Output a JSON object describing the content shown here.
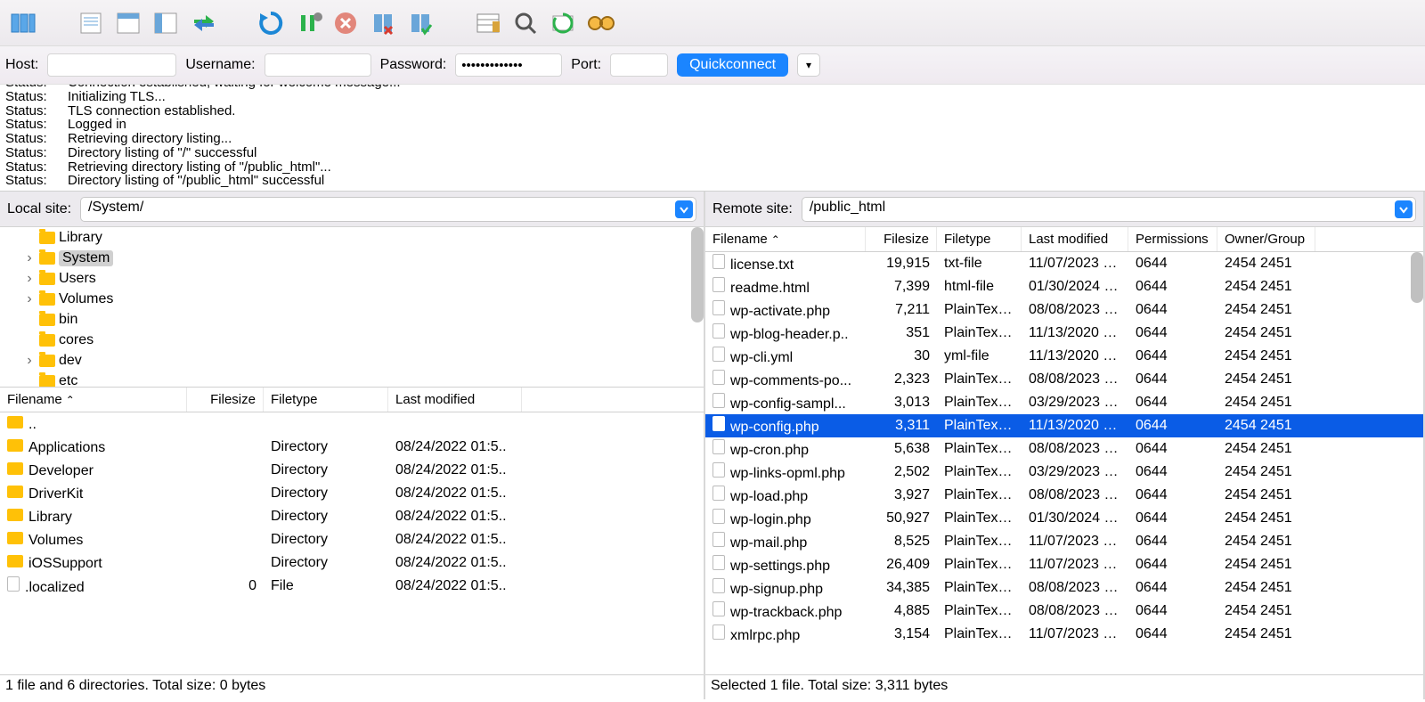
{
  "conn": {
    "host_label": "Host:",
    "username_label": "Username:",
    "password_label": "Password:",
    "password_mask": "•••••••••••••",
    "port_label": "Port:",
    "quickconnect": "Quickconnect"
  },
  "log": [
    {
      "k": "Status:",
      "v": "Connection established, waiting for welcome message..."
    },
    {
      "k": "Status:",
      "v": "Initializing TLS..."
    },
    {
      "k": "Status:",
      "v": "TLS connection established."
    },
    {
      "k": "Status:",
      "v": "Logged in"
    },
    {
      "k": "Status:",
      "v": "Retrieving directory listing..."
    },
    {
      "k": "Status:",
      "v": "Directory listing of \"/\" successful"
    },
    {
      "k": "Status:",
      "v": "Retrieving directory listing of \"/public_html\"..."
    },
    {
      "k": "Status:",
      "v": "Directory listing of \"/public_html\" successful"
    }
  ],
  "local": {
    "label": "Local site:",
    "path": "/System/",
    "tree": [
      {
        "caret": "",
        "name": "Library",
        "sel": false
      },
      {
        "caret": "›",
        "name": "System",
        "sel": true
      },
      {
        "caret": "›",
        "name": "Users",
        "sel": false
      },
      {
        "caret": "›",
        "name": "Volumes",
        "sel": false
      },
      {
        "caret": "",
        "name": "bin",
        "sel": false
      },
      {
        "caret": "",
        "name": "cores",
        "sel": false
      },
      {
        "caret": "›",
        "name": "dev",
        "sel": false
      },
      {
        "caret": "",
        "name": "etc",
        "sel": false
      }
    ],
    "headers": {
      "fn": "Filename",
      "fs": "Filesize",
      "ft": "Filetype",
      "lm": "Last modified"
    },
    "rows": [
      {
        "icon": "folder",
        "name": "..",
        "size": "",
        "type": "",
        "date": ""
      },
      {
        "icon": "folder",
        "name": "Applications",
        "size": "",
        "type": "Directory",
        "date": "08/24/2022 01:5.."
      },
      {
        "icon": "folder",
        "name": "Developer",
        "size": "",
        "type": "Directory",
        "date": "08/24/2022 01:5.."
      },
      {
        "icon": "folder",
        "name": "DriverKit",
        "size": "",
        "type": "Directory",
        "date": "08/24/2022 01:5.."
      },
      {
        "icon": "folder",
        "name": "Library",
        "size": "",
        "type": "Directory",
        "date": "08/24/2022 01:5.."
      },
      {
        "icon": "folder",
        "name": "Volumes",
        "size": "",
        "type": "Directory",
        "date": "08/24/2022 01:5.."
      },
      {
        "icon": "folder",
        "name": "iOSSupport",
        "size": "",
        "type": "Directory",
        "date": "08/24/2022 01:5.."
      },
      {
        "icon": "file",
        "name": ".localized",
        "size": "0",
        "type": "File",
        "date": "08/24/2022 01:5.."
      }
    ],
    "footer": "1 file and 6 directories. Total size: 0 bytes"
  },
  "remote": {
    "label": "Remote site:",
    "path": "/public_html",
    "headers": {
      "fn": "Filename",
      "fs": "Filesize",
      "ft": "Filetype",
      "lm": "Last modified",
      "pm": "Permissions",
      "og": "Owner/Group"
    },
    "rows": [
      {
        "name": "license.txt",
        "size": "19,915",
        "type": "txt-file",
        "date": "11/07/2023 1...",
        "perm": "0644",
        "og": "2454 2451",
        "sel": false
      },
      {
        "name": "readme.html",
        "size": "7,399",
        "type": "html-file",
        "date": "01/30/2024 1...",
        "perm": "0644",
        "og": "2454 2451",
        "sel": false
      },
      {
        "name": "wp-activate.php",
        "size": "7,211",
        "type": "PlainTextT...",
        "date": "08/08/2023 1...",
        "perm": "0644",
        "og": "2454 2451",
        "sel": false
      },
      {
        "name": "wp-blog-header.p..",
        "size": "351",
        "type": "PlainTextT...",
        "date": "11/13/2020 0...",
        "perm": "0644",
        "og": "2454 2451",
        "sel": false
      },
      {
        "name": "wp-cli.yml",
        "size": "30",
        "type": "yml-file",
        "date": "11/13/2020 1...",
        "perm": "0644",
        "og": "2454 2451",
        "sel": false
      },
      {
        "name": "wp-comments-po...",
        "size": "2,323",
        "type": "PlainTextT...",
        "date": "08/08/2023 1...",
        "perm": "0644",
        "og": "2454 2451",
        "sel": false
      },
      {
        "name": "wp-config-sampl...",
        "size": "3,013",
        "type": "PlainTextT...",
        "date": "03/29/2023 1...",
        "perm": "0644",
        "og": "2454 2451",
        "sel": false
      },
      {
        "name": "wp-config.php",
        "size": "3,311",
        "type": "PlainTextT...",
        "date": "11/13/2020 0...",
        "perm": "0644",
        "og": "2454 2451",
        "sel": true
      },
      {
        "name": "wp-cron.php",
        "size": "5,638",
        "type": "PlainTextT...",
        "date": "08/08/2023 1...",
        "perm": "0644",
        "og": "2454 2451",
        "sel": false
      },
      {
        "name": "wp-links-opml.php",
        "size": "2,502",
        "type": "PlainTextT...",
        "date": "03/29/2023 1...",
        "perm": "0644",
        "og": "2454 2451",
        "sel": false
      },
      {
        "name": "wp-load.php",
        "size": "3,927",
        "type": "PlainTextT...",
        "date": "08/08/2023 1...",
        "perm": "0644",
        "og": "2454 2451",
        "sel": false
      },
      {
        "name": "wp-login.php",
        "size": "50,927",
        "type": "PlainTextT...",
        "date": "01/30/2024 1...",
        "perm": "0644",
        "og": "2454 2451",
        "sel": false
      },
      {
        "name": "wp-mail.php",
        "size": "8,525",
        "type": "PlainTextT...",
        "date": "11/07/2023 1...",
        "perm": "0644",
        "og": "2454 2451",
        "sel": false
      },
      {
        "name": "wp-settings.php",
        "size": "26,409",
        "type": "PlainTextT...",
        "date": "11/07/2023 1...",
        "perm": "0644",
        "og": "2454 2451",
        "sel": false
      },
      {
        "name": "wp-signup.php",
        "size": "34,385",
        "type": "PlainTextT...",
        "date": "08/08/2023 1...",
        "perm": "0644",
        "og": "2454 2451",
        "sel": false
      },
      {
        "name": "wp-trackback.php",
        "size": "4,885",
        "type": "PlainTextT...",
        "date": "08/08/2023 1...",
        "perm": "0644",
        "og": "2454 2451",
        "sel": false
      },
      {
        "name": "xmlrpc.php",
        "size": "3,154",
        "type": "PlainTextT...",
        "date": "11/07/2023 1...",
        "perm": "0644",
        "og": "2454 2451",
        "sel": false
      }
    ],
    "footer": "Selected 1 file. Total size: 3,311 bytes"
  }
}
